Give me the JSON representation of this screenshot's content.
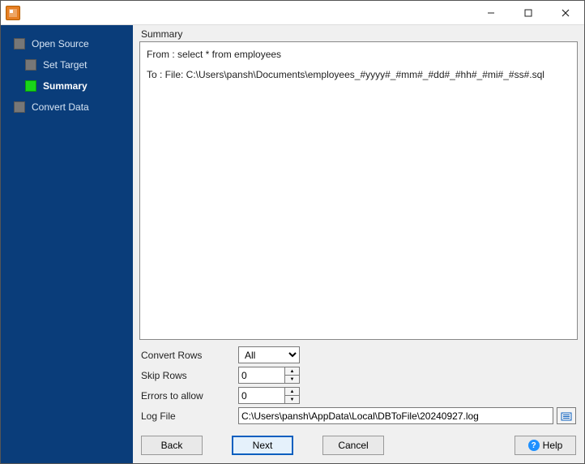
{
  "titlebar": {
    "title": ""
  },
  "sidebar": {
    "steps": [
      {
        "label": "Open Source",
        "active": false,
        "sub": false
      },
      {
        "label": "Set Target",
        "active": false,
        "sub": true
      },
      {
        "label": "Summary",
        "active": true,
        "sub": true
      },
      {
        "label": "Convert Data",
        "active": false,
        "sub": false
      }
    ]
  },
  "main": {
    "section_title": "Summary",
    "from_line": "From : select * from employees",
    "to_line": "To : File: C:\\Users\\pansh\\Documents\\employees_#yyyy#_#mm#_#dd#_#hh#_#mi#_#ss#.sql"
  },
  "options": {
    "convert_rows": {
      "label": "Convert Rows",
      "value": "All"
    },
    "skip_rows": {
      "label": "Skip Rows",
      "value": "0"
    },
    "errors": {
      "label": "Errors to allow",
      "value": "0"
    },
    "log_file": {
      "label": "Log File",
      "value": "C:\\Users\\pansh\\AppData\\Local\\DBToFile\\20240927.log"
    }
  },
  "footer": {
    "back": "Back",
    "next": "Next",
    "cancel": "Cancel",
    "help": "Help"
  }
}
